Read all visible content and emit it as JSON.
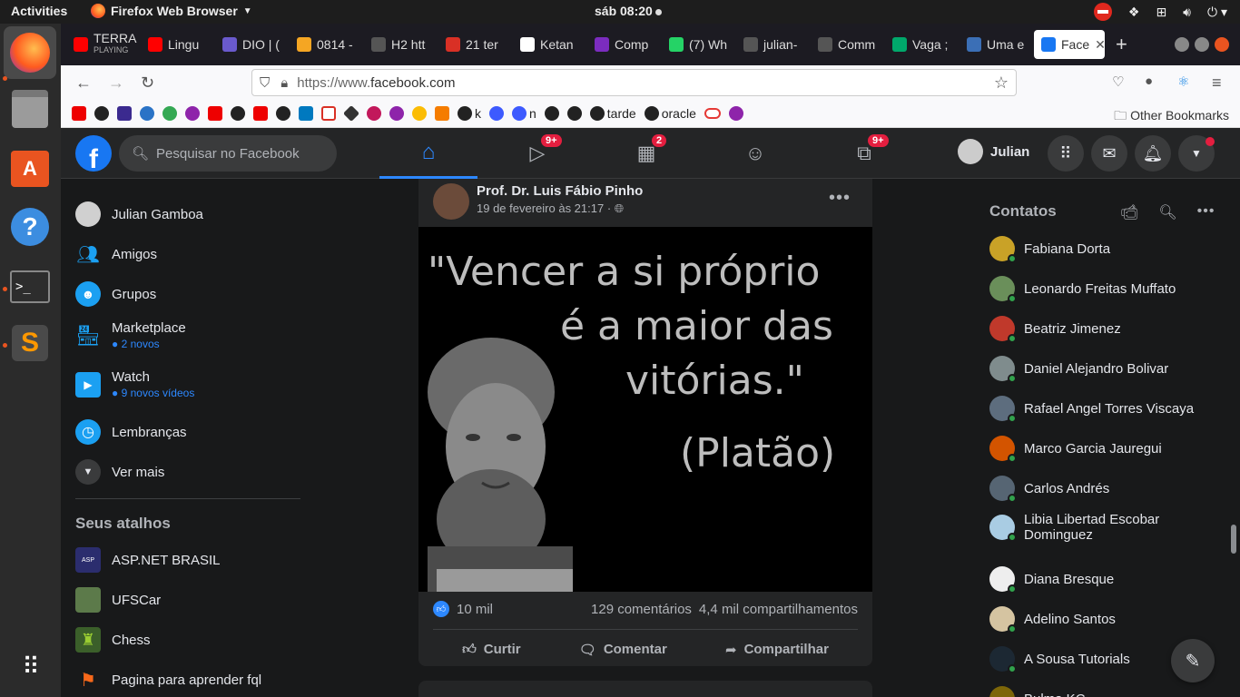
{
  "os": {
    "activities": "Activities",
    "app_name": "Firefox Web Browser",
    "clock": "sáb 08:20"
  },
  "browser": {
    "tabs": [
      {
        "label": "TERRA",
        "sub": "PLAYING",
        "color": "#ff0000"
      },
      {
        "label": "Lingu",
        "color": "#ff0000"
      },
      {
        "label": "DIO | (",
        "color": "#6a5acd"
      },
      {
        "label": "0814 -",
        "color": "#f5a623"
      },
      {
        "label": "H2 htt",
        "color": "#555"
      },
      {
        "label": "21 ter",
        "color": "#d93025"
      },
      {
        "label": "Ketan",
        "color": "#fff"
      },
      {
        "label": "Comp",
        "color": "#7b2cbf"
      },
      {
        "label": "(7) Wh",
        "color": "#25d366"
      },
      {
        "label": "julian-",
        "color": "#555"
      },
      {
        "label": "Comm",
        "color": "#555"
      },
      {
        "label": "Vaga ;",
        "color": "#00a86b"
      },
      {
        "label": "Uma e",
        "color": "#3b6fb6"
      },
      {
        "label": "Face",
        "color": "#1877f2"
      }
    ],
    "url_prefix": "https://www.",
    "url_domain": "facebook.com",
    "bookmarks_text": [
      "k",
      "n",
      "tarde",
      "oracle"
    ],
    "other_bookmarks": "Other Bookmarks"
  },
  "facebook": {
    "search_placeholder": "Pesquisar no Facebook",
    "badges": {
      "watch": "9+",
      "marketplace": "2",
      "gaming": "9+"
    },
    "user_short": "Julian",
    "left_menu": {
      "profile": "Julian Gamboa",
      "friends": "Amigos",
      "groups": "Grupos",
      "marketplace": "Marketplace",
      "marketplace_sub": "2 novos",
      "watch": "Watch",
      "watch_sub": "9 novos vídeos",
      "memories": "Lembranças",
      "see_more": "Ver mais",
      "shortcuts_title": "Seus atalhos",
      "shortcuts": [
        "ASP.NET BRASIL",
        "UFSCar",
        "Chess",
        "Pagina para aprender fql"
      ]
    },
    "post": {
      "author": "Prof. Dr. Luis Fábio Pinho",
      "time": "19 de fevereiro às 21:17 ·",
      "quote_line1": "\"Vencer a si próprio",
      "quote_line2": "é a maior das",
      "quote_line3": "vitórias.\"",
      "quote_author": "(Platão)",
      "likes": "10 mil",
      "comments": "129 comentários",
      "shares": "4,4 mil compartilhamentos",
      "like_label": "Curtir",
      "comment_label": "Comentar",
      "share_label": "Compartilhar"
    },
    "contacts_title": "Contatos",
    "contacts": [
      "Fabiana Dorta",
      "Leonardo Freitas Muffato",
      "Beatriz Jimenez",
      "Daniel Alejandro Bolivar",
      "Rafael Angel Torres Viscaya",
      "Marco Garcia Jauregui",
      "Carlos Andrés",
      "Libia Libertad Escobar Dominguez",
      "Diana Bresque",
      "Adelino Santos",
      "A Sousa Tutorials",
      "Bulma KC"
    ]
  }
}
